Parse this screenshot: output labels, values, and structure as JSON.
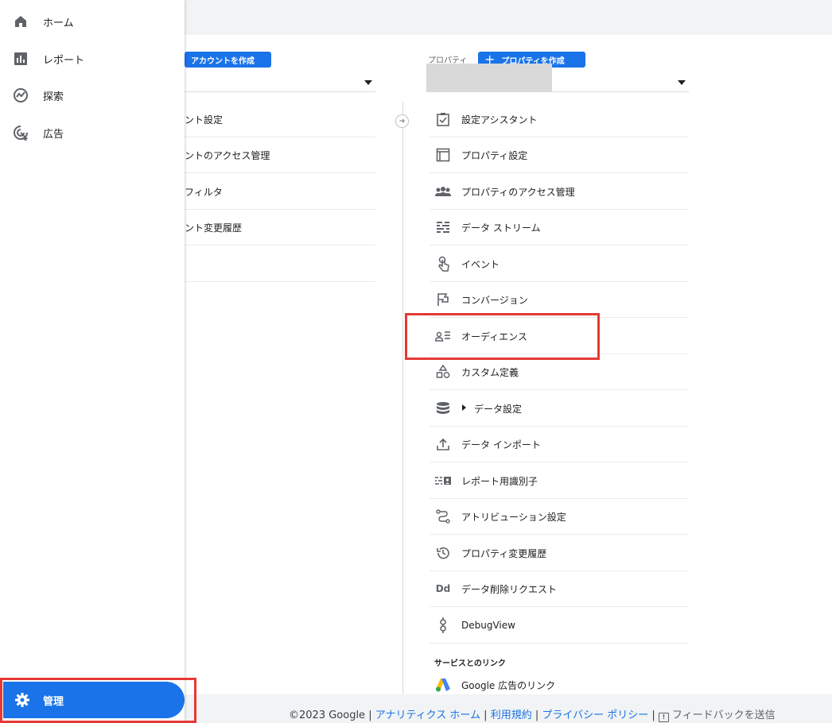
{
  "sidebar": {
    "items": [
      {
        "label": "ホーム",
        "icon": "home-icon"
      },
      {
        "label": "レポート",
        "icon": "bar-chart-icon"
      },
      {
        "label": "探索",
        "icon": "explore-icon"
      },
      {
        "label": "広告",
        "icon": "ads-icon"
      }
    ],
    "admin": {
      "label": "管理",
      "icon": "gear-icon"
    }
  },
  "account": {
    "create_button": "アカウントを作成",
    "rows": [
      "ント設定",
      "ントのアクセス管理",
      "フィルタ",
      "ント変更履歴"
    ]
  },
  "property": {
    "label": "プロパティ",
    "create_button": "プロパティを作成",
    "rows": [
      {
        "label": "設定アシスタント",
        "icon": "checklist-icon"
      },
      {
        "label": "プロパティ設定",
        "icon": "property-layout-icon"
      },
      {
        "label": "プロパティのアクセス管理",
        "icon": "people-icon"
      },
      {
        "label": "データ ストリーム",
        "icon": "data-stream-icon"
      },
      {
        "label": "イベント",
        "icon": "touch-icon"
      },
      {
        "label": "コンバージョン",
        "icon": "flag-icon"
      },
      {
        "label": "オーディエンス",
        "icon": "audience-icon"
      },
      {
        "label": "カスタム定義",
        "icon": "shapes-icon"
      },
      {
        "label": "データ設定",
        "icon": "database-icon"
      },
      {
        "label": "データ インポート",
        "icon": "upload-icon"
      },
      {
        "label": "レポート用識別子",
        "icon": "identity-icon"
      },
      {
        "label": "アトリビューション設定",
        "icon": "attribution-icon"
      },
      {
        "label": "プロパティ変更履歴",
        "icon": "history-icon"
      },
      {
        "label": "データ削除リクエスト",
        "icon": "dd-icon"
      },
      {
        "label": "DebugView",
        "icon": "debug-icon"
      }
    ],
    "links_section": "サービスとのリンク",
    "google_ads_link": "Google 広告のリンク"
  },
  "footer": {
    "copyright": "©2023 Google",
    "links": [
      "アナリティクス ホーム",
      "利用規約",
      "プライバシー ポリシー"
    ],
    "feedback": "フィードバックを送信"
  },
  "colors": {
    "accent": "#1a73e8",
    "highlight": "#e53935"
  }
}
